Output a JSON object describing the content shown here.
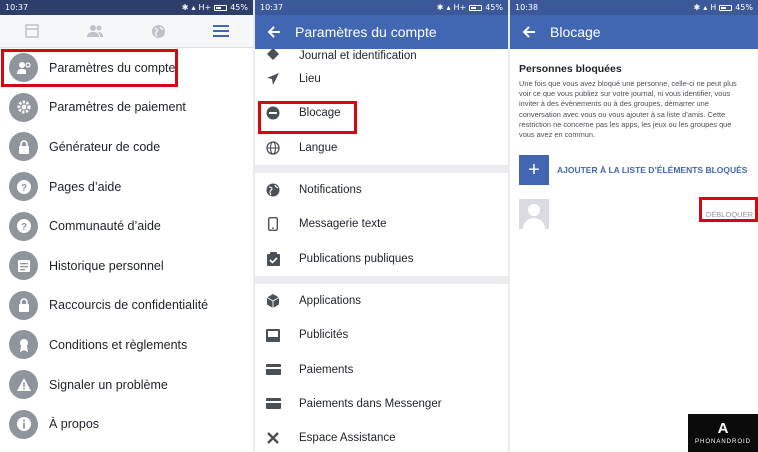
{
  "panel1": {
    "status": {
      "time": "10:37",
      "network": "H+",
      "battery": "45%"
    },
    "tabs": [
      {
        "icon": "news-feed-icon"
      },
      {
        "icon": "friends-icon"
      },
      {
        "icon": "globe-icon"
      },
      {
        "icon": "hamburger-menu-icon"
      }
    ],
    "items": [
      {
        "label": "Paramètres du compte",
        "icon": "user-settings-icon"
      },
      {
        "label": "Paramètres de paiement",
        "icon": "gear-icon"
      },
      {
        "label": "Générateur de code",
        "icon": "lock-icon"
      },
      {
        "label": "Pages d’aide",
        "icon": "question-icon"
      },
      {
        "label": "Communauté d’aide",
        "icon": "question-icon"
      },
      {
        "label": "Historique personnel",
        "icon": "list-icon"
      },
      {
        "label": "Raccourcis de confidentialité",
        "icon": "lock-icon"
      },
      {
        "label": "Conditions et règlements",
        "icon": "badge-icon"
      },
      {
        "label": "Signaler un problème",
        "icon": "warning-icon"
      },
      {
        "label": "À propos",
        "icon": "info-icon"
      }
    ]
  },
  "panel2": {
    "status": {
      "time": "10:37",
      "network": "H+",
      "battery": "45%"
    },
    "title": "Paramètres du compte",
    "partial_item": "Journal et identification",
    "groups": [
      [
        {
          "label": "Lieu",
          "icon": "location-arrow-icon"
        },
        {
          "label": "Blocage",
          "icon": "block-icon"
        },
        {
          "label": "Langue",
          "icon": "globe-icon"
        }
      ],
      [
        {
          "label": "Notifications",
          "icon": "globe-icon"
        },
        {
          "label": "Messagerie texte",
          "icon": "phone-icon"
        },
        {
          "label": "Publications publiques",
          "icon": "clipboard-check-icon"
        }
      ],
      [
        {
          "label": "Applications",
          "icon": "cube-icon"
        },
        {
          "label": "Publicités",
          "icon": "monitor-icon"
        },
        {
          "label": "Paiements",
          "icon": "card-icon"
        },
        {
          "label": "Paiements dans Messenger",
          "icon": "card-icon"
        },
        {
          "label": "Espace Assistance",
          "icon": "tools-icon"
        }
      ]
    ]
  },
  "panel3": {
    "status": {
      "time": "10:38",
      "network": "H",
      "battery": "45%"
    },
    "title": "Blocage",
    "section_title": "Personnes bloquées",
    "description": "Une fois que vous avez bloqué une personne, celle-ci ne peut plus voir ce que vous publiez sur votre journal, ni vous identifier, vous inviter à des évènements ou à des groupes, démarrer une conversation avec vous ou vous ajouter à sa liste d’amis. Cette restriction ne concerne pas les apps, les jeux ou les groupes que vous avez en commun.",
    "add_label": "AJOUTER À LA LISTE D’ÉLÉMENTS BLOQUÉS",
    "unblock_label": "DÉBLOQUER"
  },
  "watermark": {
    "logo": "A",
    "text": "PHONANDROID"
  },
  "colors": {
    "facebook_blue": "#4267b2",
    "highlight_red": "#d6080f",
    "icon_gray": "#90949c"
  }
}
